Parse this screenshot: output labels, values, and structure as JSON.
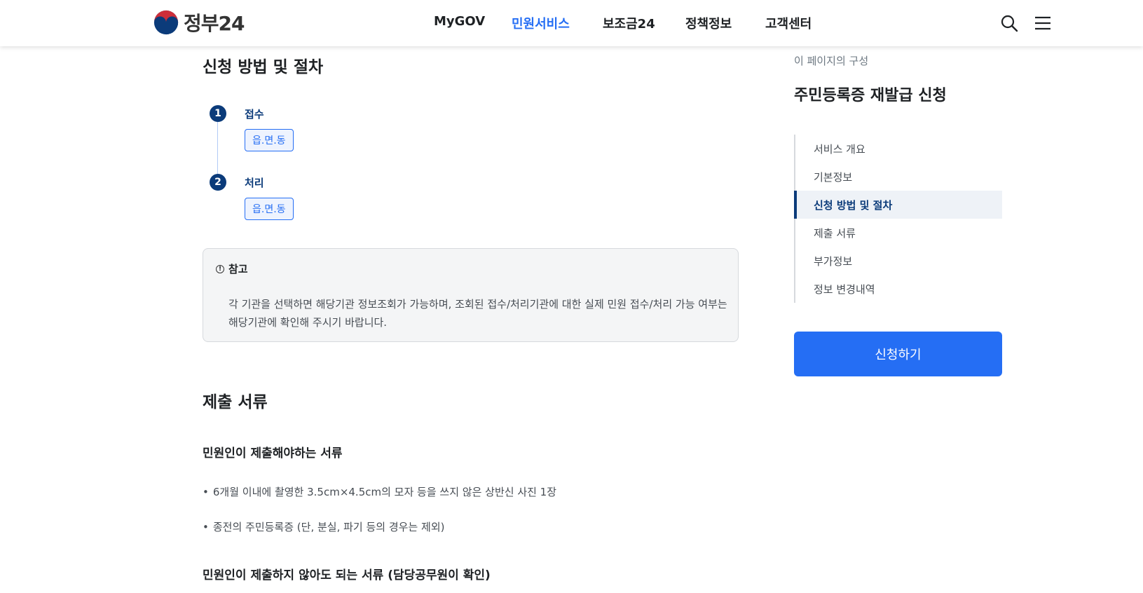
{
  "header": {
    "logo_text": "정부24",
    "nav": [
      "MyGOV",
      "민원서비스",
      "보조금24",
      "정책정보",
      "고객센터"
    ],
    "active_nav": "민원서비스"
  },
  "procedure": {
    "heading": "신청 방법 및 절차",
    "steps": [
      {
        "num": "1",
        "title": "접수",
        "org": "읍.면.동"
      },
      {
        "num": "2",
        "title": "처리",
        "org": "읍.면.동"
      }
    ],
    "notice": {
      "title": "참고",
      "body": "각 기관을 선택하면 해당기관 정보조회가 가능하며, 조회된 접수/처리기관에 대한 실제 민원 접수/처리 가능 여부는 해당기관에 확인해 주시기 바랍니다."
    }
  },
  "documents": {
    "heading": "제출 서류",
    "required_title": "민원인이 제출해야하는 서류",
    "required_items": [
      "6개월 이내에 촬영한 3.5cm×4.5cm의 모자 등을 쓰지 않은 상반신 사진 1장",
      "종전의 주민등록증 (단, 분실, 파기 등의 경우는 제외)"
    ],
    "not_required_title": "민원인이 제출하지 않아도 되는 서류 (담당공무원이 확인)"
  },
  "aside": {
    "caption": "이 페이지의 구성",
    "title": "주민등록증 재발급 신청",
    "toc": [
      "서비스 개요",
      "기본정보",
      "신청 방법 및 절차",
      "제출 서류",
      "부가정보",
      "정보 변경내역"
    ],
    "active_toc": "신청 방법 및 절차",
    "apply_label": "신청하기"
  },
  "colors": {
    "primary": "#256ef4",
    "navy": "#0b3b7a"
  }
}
